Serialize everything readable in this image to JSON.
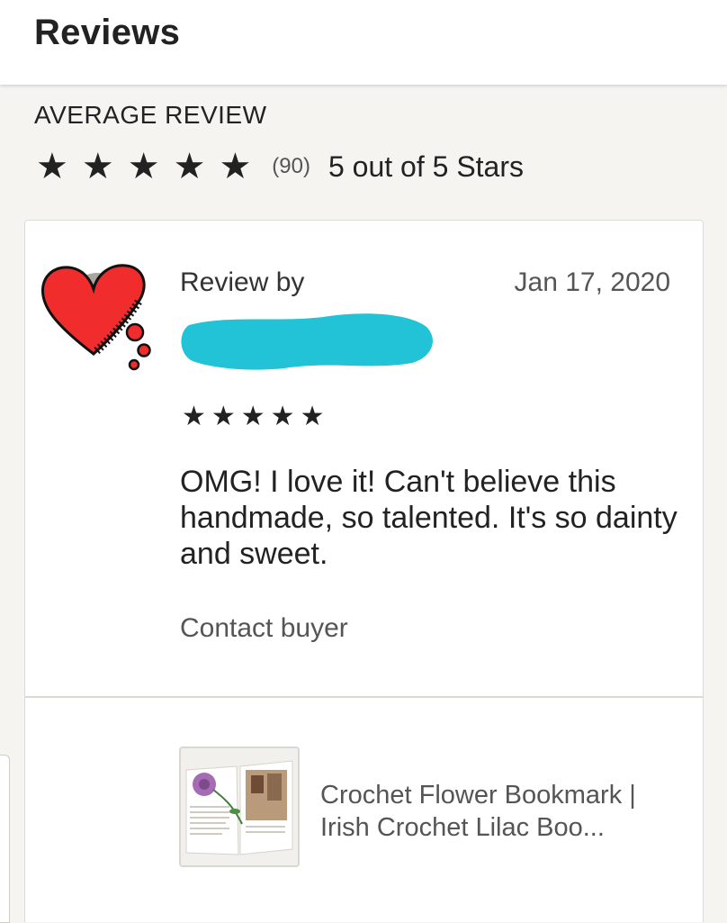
{
  "header": {
    "title": "Reviews"
  },
  "average": {
    "label": "AVERAGE REVIEW",
    "stars": 5,
    "count": "(90)",
    "text": "5 out of 5 Stars"
  },
  "review": {
    "by_label": "Review by",
    "date": "Jan 17, 2020",
    "stars": "★★★★★",
    "text": "OMG!  I love it!  Can't believe this handmade, so talented. It's so dainty and sweet.",
    "contact_label": "Contact buyer"
  },
  "listing": {
    "title": "Crochet Flower Bookmark | Irish Crochet Lilac Boo..."
  },
  "colors": {
    "redaction": "#22c3d6",
    "heart": "#f02c2c"
  }
}
